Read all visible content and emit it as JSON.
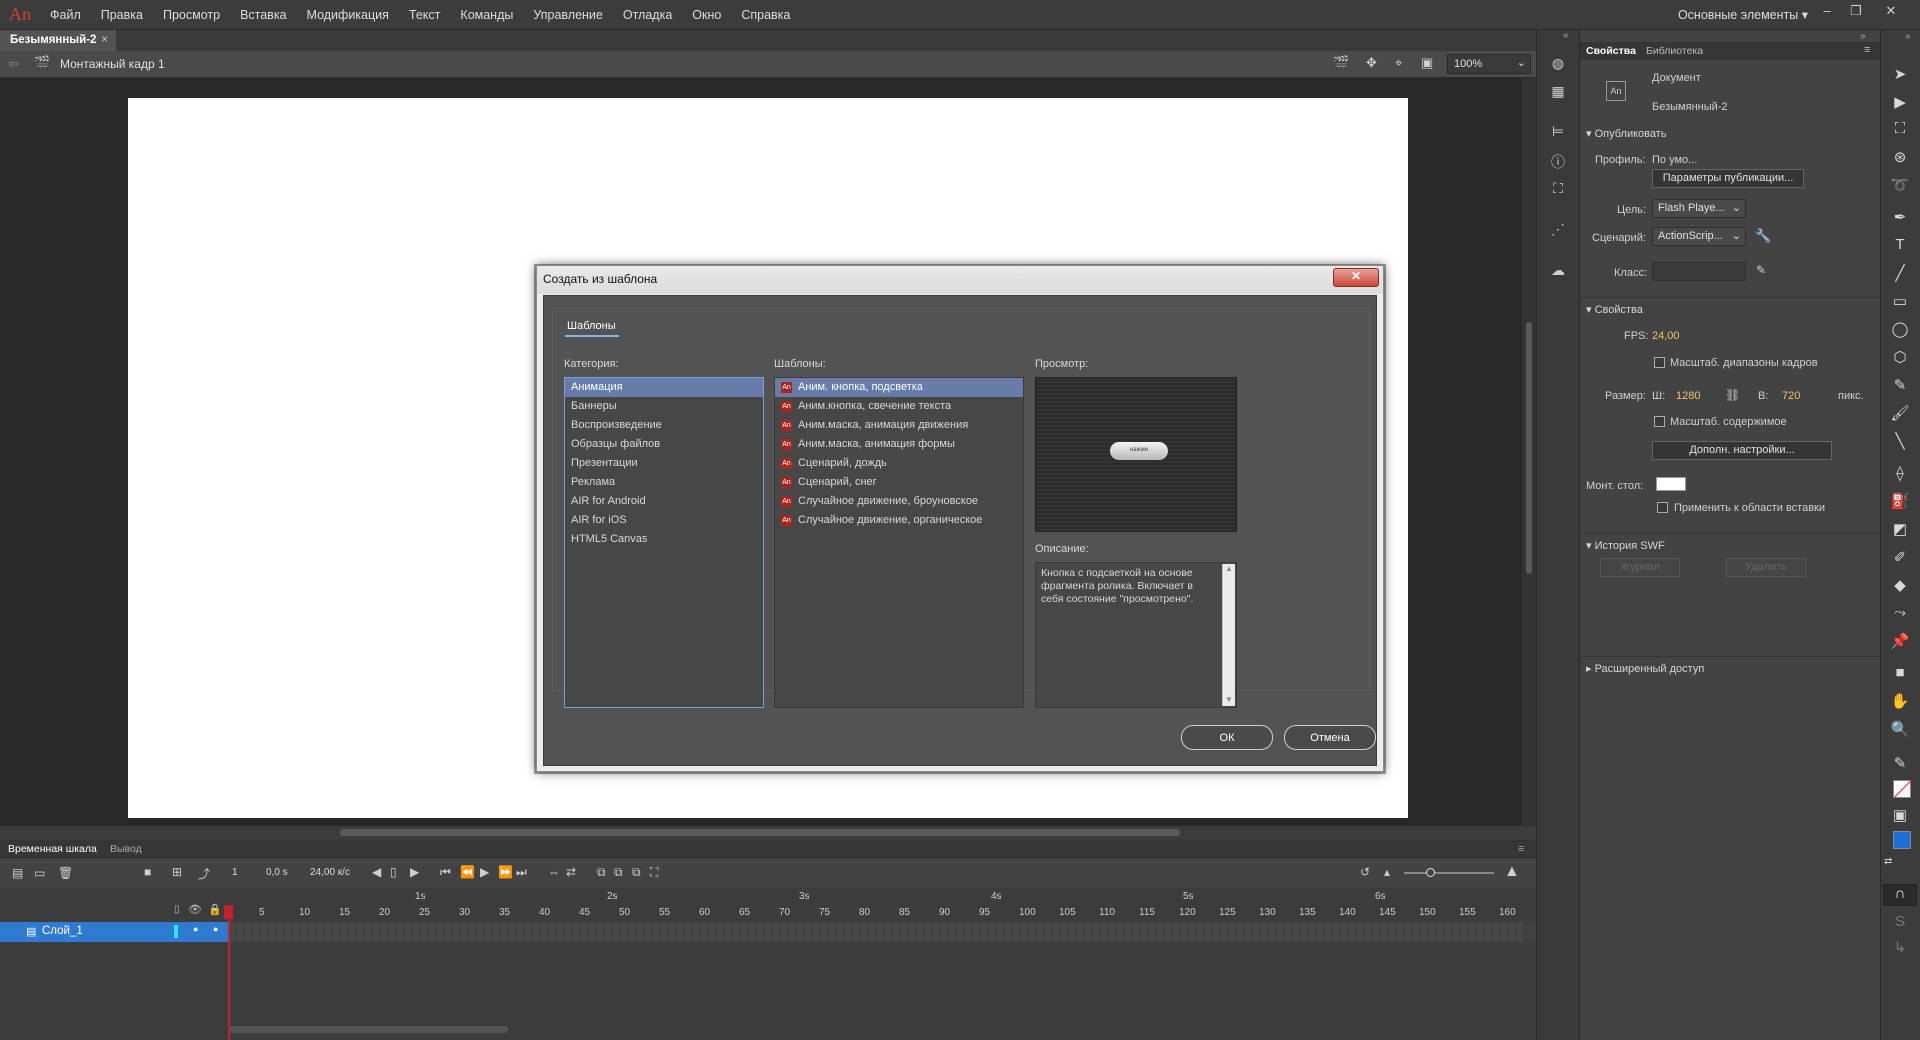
{
  "app": {
    "logo": "An",
    "menu": [
      "Файл",
      "Правка",
      "Просмотр",
      "Вставка",
      "Модификация",
      "Текст",
      "Команды",
      "Управление",
      "Отладка",
      "Окно",
      "Справка"
    ],
    "workspace": "Основные элементы",
    "workspace_arrow": "▾",
    "window_controls": [
      "‒",
      "❐",
      "✕"
    ]
  },
  "document": {
    "tab_title": "Безымянный-2",
    "tab_close": "×",
    "scene": "Монтажный кадр 1",
    "zoom": "100%",
    "zoom_arrow": "⌄"
  },
  "dialog": {
    "title": "Создать из шаблона",
    "close": "✕",
    "tab": "Шаблоны",
    "category_label": "Категория:",
    "categories": [
      "Анимация",
      "Баннеры",
      "Воспроизведение",
      "Образцы файлов",
      "Презентации",
      "Реклама",
      "AIR for Android",
      "AIR for iOS",
      "HTML5 Canvas"
    ],
    "templates_label": "Шаблоны:",
    "templates": [
      "Аним. кнопка, подсветка",
      "Аним.кнопка, свечение текста",
      "Аним.маска, анимация движения",
      "Аним.маска, анимация формы",
      "Сценарий, дождь",
      "Сценарий, снег",
      "Случайное движение, броуновское",
      "Случайное движение, органическое"
    ],
    "template_icon": "An",
    "preview_label": "Просмотр:",
    "preview_button": "нажми",
    "description_label": "Описание:",
    "description": "Кнопка с подсветкой на основе фрагмента ролика. Включает в себя состояние \"просмотрено\".",
    "ok": "ОК",
    "cancel": "Отмена"
  },
  "timeline": {
    "tab_timeline": "Временная шкала",
    "tab_output": "Вывод",
    "frame": "1",
    "time": "0,0 s",
    "fps": "24,00 к/с",
    "seconds": [
      "1s",
      "2s",
      "3s",
      "4s",
      "5s",
      "6s"
    ],
    "frame_numbers": [
      "1",
      "5",
      "10",
      "15",
      "20",
      "25",
      "30",
      "35",
      "40",
      "45",
      "50",
      "55",
      "60",
      "65",
      "70",
      "75",
      "80",
      "85",
      "90",
      "95",
      "100",
      "105",
      "110",
      "115",
      "120",
      "125",
      "130",
      "135",
      "140",
      "145",
      "150",
      "155",
      "160"
    ],
    "layer": "Слой_1"
  },
  "properties": {
    "tab_properties": "Свойства",
    "tab_library": "Библиотека",
    "doc_icon": "An",
    "doc_type": "Документ",
    "doc_name": "Безымянный-2",
    "publish_section": "Опубликовать",
    "profile_label": "Профиль:",
    "profile_value": "По умо...",
    "publish_settings": "Параметры публикации...",
    "target_label": "Цель:",
    "target_value": "Flash Playe...",
    "script_label": "Сценарий:",
    "script_value": "ActionScrip...",
    "class_label": "Класс:",
    "props_section": "Свойства",
    "fps_label": "FPS:",
    "fps_value": "24,00",
    "scale_spans": "Масштаб. диапазоны кадров",
    "size_label": "Размер:",
    "w_label": "Ш:",
    "w_value": "1280",
    "h_label": "В:",
    "h_value": "720",
    "unit": "пикс.",
    "scale_content": "Масштаб. содержимое",
    "advanced": "Дополн. настройки...",
    "stage_label": "Монт. стол:",
    "apply_paste": "Применить к области вставки",
    "stage_color": "#ffffff",
    "swf_section": "История SWF",
    "journal": "Журнал",
    "delete": "Удалить",
    "access_section": "Расширенный доступ"
  },
  "colors": {
    "accent": "#2f7bd1",
    "playhead": "#c8202a",
    "fill_color": "#1b6fd6"
  }
}
